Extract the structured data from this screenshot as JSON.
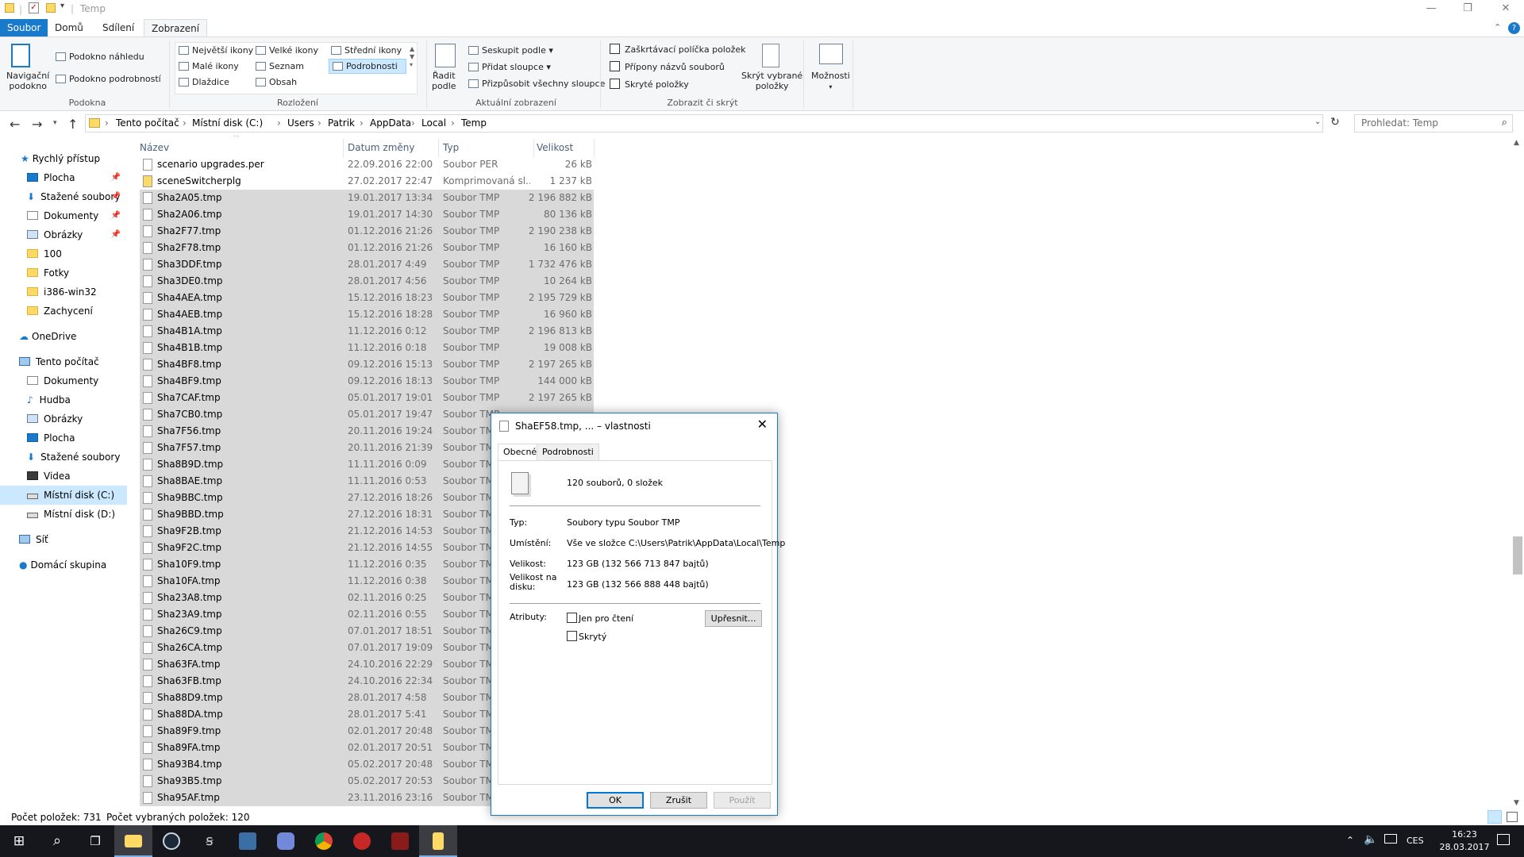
{
  "window": {
    "title": "Temp"
  },
  "ribbon": {
    "tabs": [
      "Soubor",
      "Domů",
      "Sdílení",
      "Zobrazení"
    ],
    "pane_group": {
      "nav_pane": "Navigační\npodokno",
      "preview": "Podokno náhledu",
      "details": "Podokno podrobností",
      "label": "Podokna"
    },
    "layout_group": {
      "items": [
        "Největší ikony",
        "Velké ikony",
        "Střední ikony",
        "Malé ikony",
        "Seznam",
        "Podrobnosti",
        "Dlaždice",
        "Obsah"
      ],
      "label": "Rozložení"
    },
    "view_group": {
      "sort": "Řadit\npodle",
      "group_by": "Seskupit podle",
      "add_columns": "Přidat sloupce",
      "fit_columns": "Přizpůsobit všechny sloupce",
      "label": "Aktuální zobrazení"
    },
    "show_group": {
      "checkboxes": "Zaškrtávací políčka položek",
      "extensions": "Přípony názvů souborů",
      "hidden": "Skryté položky",
      "hide_selected": "Skrýt vybrané\npoložky",
      "label": "Zobrazit či skrýt"
    },
    "options": "Možnosti"
  },
  "address": {
    "crumbs": [
      "Tento počítač",
      "Místní disk (C:)",
      "Users",
      "Patrik",
      "AppData",
      "Local",
      "Temp"
    ],
    "search_placeholder": "Prohledat: Temp"
  },
  "nav": {
    "quick_access": "Rychlý přístup",
    "quick_items": [
      "Plocha",
      "Stažené soubory",
      "Dokumenty",
      "Obrázky",
      "100",
      "Fotky",
      "i386-win32",
      "Zachycení"
    ],
    "onedrive": "OneDrive",
    "this_pc": "Tento počítač",
    "pc_items": [
      "Dokumenty",
      "Hudba",
      "Obrázky",
      "Plocha",
      "Stažené soubory",
      "Videa",
      "Místní disk (C:)",
      "Místní disk (D:)"
    ],
    "network": "Síť",
    "homegroup": "Domácí skupina"
  },
  "columns": {
    "name": "Název",
    "date": "Datum změny",
    "type": "Typ",
    "size": "Velikost"
  },
  "files": [
    {
      "name": "scenario upgrades.per",
      "date": "22.09.2016 22:00",
      "type": "Soubor PER",
      "size": "26 kB",
      "sel": false
    },
    {
      "name": "sceneSwitcherplg",
      "date": "27.02.2017 22:47",
      "type": "Komprimovaná sl...",
      "size": "1 237 kB",
      "sel": false
    },
    {
      "name": "Sha2A05.tmp",
      "date": "19.01.2017 13:34",
      "type": "Soubor TMP",
      "size": "2 196 882 kB",
      "sel": true
    },
    {
      "name": "Sha2A06.tmp",
      "date": "19.01.2017 14:30",
      "type": "Soubor TMP",
      "size": "80 136 kB",
      "sel": true
    },
    {
      "name": "Sha2F77.tmp",
      "date": "01.12.2016 21:26",
      "type": "Soubor TMP",
      "size": "2 190 238 kB",
      "sel": true
    },
    {
      "name": "Sha2F78.tmp",
      "date": "01.12.2016 21:26",
      "type": "Soubor TMP",
      "size": "16 160 kB",
      "sel": true
    },
    {
      "name": "Sha3DDF.tmp",
      "date": "28.01.2017 4:49",
      "type": "Soubor TMP",
      "size": "1 732 476 kB",
      "sel": true
    },
    {
      "name": "Sha3DE0.tmp",
      "date": "28.01.2017 4:56",
      "type": "Soubor TMP",
      "size": "10 264 kB",
      "sel": true
    },
    {
      "name": "Sha4AEA.tmp",
      "date": "15.12.2016 18:23",
      "type": "Soubor TMP",
      "size": "2 195 729 kB",
      "sel": true
    },
    {
      "name": "Sha4AEB.tmp",
      "date": "15.12.2016 18:28",
      "type": "Soubor TMP",
      "size": "16 960 kB",
      "sel": true
    },
    {
      "name": "Sha4B1A.tmp",
      "date": "11.12.2016 0:12",
      "type": "Soubor TMP",
      "size": "2 196 813 kB",
      "sel": true
    },
    {
      "name": "Sha4B1B.tmp",
      "date": "11.12.2016 0:18",
      "type": "Soubor TMP",
      "size": "19 008 kB",
      "sel": true
    },
    {
      "name": "Sha4BF8.tmp",
      "date": "09.12.2016 15:13",
      "type": "Soubor TMP",
      "size": "2 197 265 kB",
      "sel": true
    },
    {
      "name": "Sha4BF9.tmp",
      "date": "09.12.2016 18:13",
      "type": "Soubor TMP",
      "size": "144 000 kB",
      "sel": true
    },
    {
      "name": "Sha7CAF.tmp",
      "date": "05.01.2017 19:01",
      "type": "Soubor TMP",
      "size": "2 197 265 kB",
      "sel": true
    },
    {
      "name": "Sha7CB0.tmp",
      "date": "05.01.2017 19:47",
      "type": "Soubor TMP",
      "size": "",
      "sel": true
    },
    {
      "name": "Sha7F56.tmp",
      "date": "20.11.2016 19:24",
      "type": "Soubor TMP",
      "size": "",
      "sel": true
    },
    {
      "name": "Sha7F57.tmp",
      "date": "20.11.2016 21:39",
      "type": "Soubor TMP",
      "size": "",
      "sel": true
    },
    {
      "name": "Sha8B9D.tmp",
      "date": "11.11.2016 0:09",
      "type": "Soubor TMP",
      "size": "",
      "sel": true
    },
    {
      "name": "Sha8BAE.tmp",
      "date": "11.11.2016 0:53",
      "type": "Soubor TMP",
      "size": "",
      "sel": true
    },
    {
      "name": "Sha9BBC.tmp",
      "date": "27.12.2016 18:26",
      "type": "Soubor TMP",
      "size": "",
      "sel": true
    },
    {
      "name": "Sha9BBD.tmp",
      "date": "27.12.2016 18:31",
      "type": "Soubor TMP",
      "size": "",
      "sel": true
    },
    {
      "name": "Sha9F2B.tmp",
      "date": "21.12.2016 14:53",
      "type": "Soubor TMP",
      "size": "",
      "sel": true
    },
    {
      "name": "Sha9F2C.tmp",
      "date": "21.12.2016 14:55",
      "type": "Soubor TMP",
      "size": "",
      "sel": true
    },
    {
      "name": "Sha10F9.tmp",
      "date": "11.12.2016 0:35",
      "type": "Soubor TMP",
      "size": "",
      "sel": true
    },
    {
      "name": "Sha10FA.tmp",
      "date": "11.12.2016 0:38",
      "type": "Soubor TMP",
      "size": "",
      "sel": true
    },
    {
      "name": "Sha23A8.tmp",
      "date": "02.11.2016 0:25",
      "type": "Soubor TMP",
      "size": "",
      "sel": true
    },
    {
      "name": "Sha23A9.tmp",
      "date": "02.11.2016 0:55",
      "type": "Soubor TMP",
      "size": "",
      "sel": true
    },
    {
      "name": "Sha26C9.tmp",
      "date": "07.01.2017 18:51",
      "type": "Soubor TMP",
      "size": "",
      "sel": true
    },
    {
      "name": "Sha26CA.tmp",
      "date": "07.01.2017 19:09",
      "type": "Soubor TMP",
      "size": "",
      "sel": true
    },
    {
      "name": "Sha63FA.tmp",
      "date": "24.10.2016 22:29",
      "type": "Soubor TMP",
      "size": "",
      "sel": true
    },
    {
      "name": "Sha63FB.tmp",
      "date": "24.10.2016 22:34",
      "type": "Soubor TMP",
      "size": "",
      "sel": true
    },
    {
      "name": "Sha88D9.tmp",
      "date": "28.01.2017 4:58",
      "type": "Soubor TMP",
      "size": "",
      "sel": true
    },
    {
      "name": "Sha88DA.tmp",
      "date": "28.01.2017 5:41",
      "type": "Soubor TMP",
      "size": "",
      "sel": true
    },
    {
      "name": "Sha89F9.tmp",
      "date": "02.01.2017 20:48",
      "type": "Soubor TMP",
      "size": "",
      "sel": true
    },
    {
      "name": "Sha89FA.tmp",
      "date": "02.01.2017 20:51",
      "type": "Soubor TMP",
      "size": "",
      "sel": true
    },
    {
      "name": "Sha93B4.tmp",
      "date": "05.02.2017 20:48",
      "type": "Soubor TMP",
      "size": "",
      "sel": true
    },
    {
      "name": "Sha93B5.tmp",
      "date": "05.02.2017 20:53",
      "type": "Soubor TMP",
      "size": "",
      "sel": true
    },
    {
      "name": "Sha95AF.tmp",
      "date": "23.11.2016 23:16",
      "type": "Soubor TMP",
      "size": "",
      "sel": true
    }
  ],
  "status": {
    "count": "Počet položek: 731",
    "selected": "Počet vybraných položek: 120"
  },
  "dialog": {
    "title": "ShaEF58.tmp, ... – vlastnosti",
    "tabs": [
      "Obecné",
      "Podrobnosti"
    ],
    "summary": "120 souborů, 0 složek",
    "type_label": "Typ:",
    "type_value": "Soubory typu Soubor TMP",
    "location_label": "Umístění:",
    "location_value": "Vše ve složce C:\\Users\\Patrik\\AppData\\Local\\Temp",
    "size_label": "Velikost:",
    "size_value": "123 GB (132 566 713 847 bajtů)",
    "disk_label": "Velikost na\ndisku:",
    "disk_value": "123 GB (132 566 888 448 bajtů)",
    "attr_label": "Atributy:",
    "readonly": "Jen pro čtení",
    "hidden": "Skrytý",
    "advanced": "Upřesnit...",
    "ok": "OK",
    "cancel": "Zrušit",
    "apply": "Použít"
  },
  "tray": {
    "lang": "CES",
    "time": "16:23",
    "date": "28.03.2017"
  },
  "colors": {
    "accent": "#1979ca",
    "selection": "#d9d9d9",
    "taskbar": "#15171c"
  }
}
